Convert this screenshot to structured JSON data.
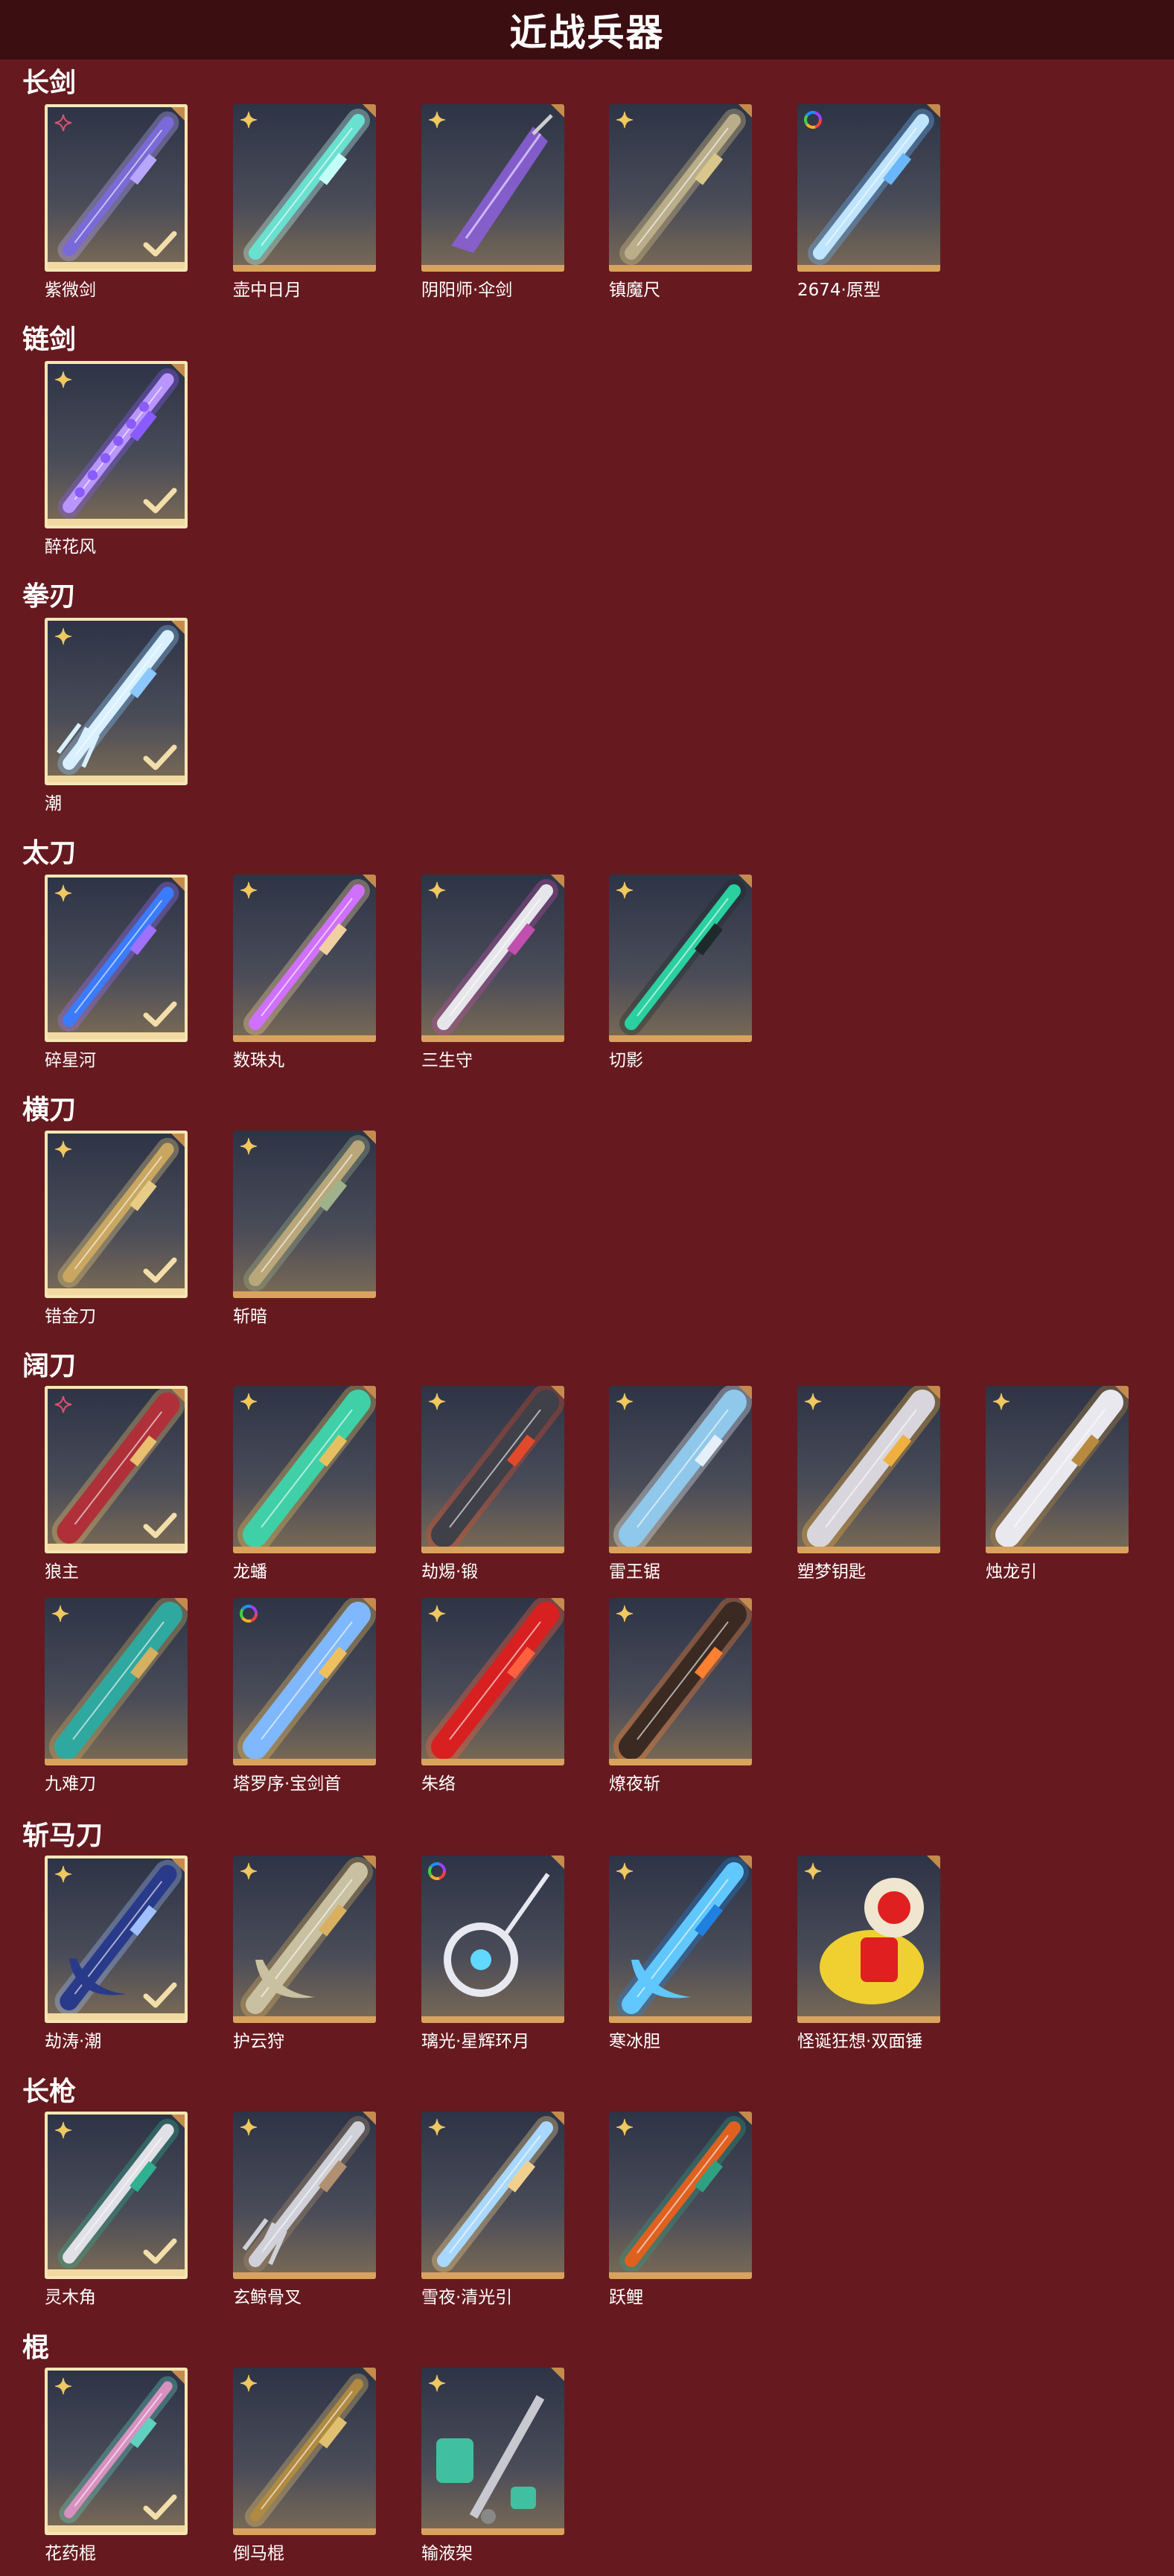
{
  "page_title": "近战兵器",
  "colors": {
    "background": "#661a1f",
    "header": "#3b0e12",
    "gold": "#d9a35e",
    "selected_border": "#f7e6b4"
  },
  "categories": [
    {
      "name": "长剑",
      "items": [
        {
          "name": "紫微剑",
          "badge": "red-star-icon",
          "selected": true,
          "art": {
            "kind": "sword",
            "blade": "#7a6ad8",
            "glow": "#b9a7ff"
          }
        },
        {
          "name": "壶中日月",
          "badge": "gold-star-icon",
          "selected": false,
          "art": {
            "kind": "sword",
            "blade": "#69e0d0",
            "glow": "#c4fff7"
          }
        },
        {
          "name": "阴阳师·伞剑",
          "badge": "gold-star-icon",
          "selected": false,
          "art": {
            "kind": "umbrella",
            "blade": "#8a5fd6",
            "glow": "#cdb6ff"
          }
        },
        {
          "name": "镇魔尺",
          "badge": "gold-star-icon",
          "selected": false,
          "art": {
            "kind": "sword",
            "blade": "#b9ad8a",
            "glow": "#d9c68b"
          }
        },
        {
          "name": "2674·原型",
          "badge": "rainbow-ring-icon",
          "selected": false,
          "art": {
            "kind": "sword",
            "blade": "#bfe4ff",
            "glow": "#6bb7ff"
          }
        }
      ]
    },
    {
      "name": "链剑",
      "items": [
        {
          "name": "醉花风",
          "badge": "gold-star-icon",
          "selected": true,
          "art": {
            "kind": "chain",
            "blade": "#b996ff",
            "glow": "#8a5cff"
          }
        }
      ]
    },
    {
      "name": "拳刃",
      "items": [
        {
          "name": "潮",
          "badge": "gold-star-icon",
          "selected": true,
          "art": {
            "kind": "claw",
            "blade": "#d8f0ff",
            "glow": "#8cc8ff"
          }
        }
      ]
    },
    {
      "name": "太刀",
      "items": [
        {
          "name": "碎星河",
          "badge": "gold-star-icon",
          "selected": true,
          "art": {
            "kind": "katana",
            "blade": "#3a7bff",
            "glow": "#a070ff"
          }
        },
        {
          "name": "数珠丸",
          "badge": "gold-star-icon",
          "selected": false,
          "art": {
            "kind": "katana",
            "blade": "#d070ff",
            "glow": "#f0d0a0"
          }
        },
        {
          "name": "三生守",
          "badge": "gold-star-icon",
          "selected": false,
          "art": {
            "kind": "katana",
            "blade": "#e6e6ea",
            "glow": "#c04fb0"
          }
        },
        {
          "name": "切影",
          "badge": "gold-star-icon",
          "selected": false,
          "art": {
            "kind": "katana",
            "blade": "#2ad0a0",
            "glow": "#1e2a2a"
          }
        }
      ]
    },
    {
      "name": "横刀",
      "items": [
        {
          "name": "错金刀",
          "badge": "gold-star-icon",
          "selected": true,
          "art": {
            "kind": "katana",
            "blade": "#c9a760",
            "glow": "#e6cc86"
          }
        },
        {
          "name": "斩暗",
          "badge": "gold-star-icon",
          "selected": false,
          "art": {
            "kind": "katana",
            "blade": "#b9a77a",
            "glow": "#9fb28c"
          }
        }
      ]
    },
    {
      "name": "阔刀",
      "items": [
        {
          "name": "狼主",
          "badge": "red-star-icon",
          "selected": true,
          "art": {
            "kind": "broad",
            "blade": "#b0303a",
            "glow": "#e8c070"
          }
        },
        {
          "name": "龙蟠",
          "badge": "gold-star-icon",
          "selected": false,
          "art": {
            "kind": "broad",
            "blade": "#3fd0a8",
            "glow": "#e6c060"
          }
        },
        {
          "name": "劫焬·锻",
          "badge": "gold-star-icon",
          "selected": false,
          "art": {
            "kind": "broad",
            "blade": "#404048",
            "glow": "#e04a2a"
          }
        },
        {
          "name": "雷王锯",
          "badge": "gold-star-icon",
          "selected": false,
          "art": {
            "kind": "broad",
            "blade": "#8fc8ea",
            "glow": "#e6eef8"
          }
        },
        {
          "name": "塑梦钥匙",
          "badge": "gold-star-icon",
          "selected": false,
          "art": {
            "kind": "broad",
            "blade": "#d8d6dc",
            "glow": "#f0b040"
          }
        },
        {
          "name": "烛龙引",
          "badge": "gold-star-icon",
          "selected": false,
          "art": {
            "kind": "broad",
            "blade": "#e8e8ee",
            "glow": "#b88a40"
          }
        },
        {
          "name": "九难刀",
          "badge": "gold-star-icon",
          "selected": false,
          "art": {
            "kind": "broad",
            "blade": "#2fa8a0",
            "glow": "#d4b060"
          }
        },
        {
          "name": "塔罗序·宝剑首",
          "badge": "rainbow-ring-icon",
          "selected": false,
          "art": {
            "kind": "broad",
            "blade": "#7fb8ff",
            "glow": "#f0c060"
          }
        },
        {
          "name": "朱络",
          "badge": "gold-star-icon",
          "selected": false,
          "art": {
            "kind": "broad",
            "blade": "#d82020",
            "glow": "#ff6040"
          }
        },
        {
          "name": "燎夜斩",
          "badge": "gold-star-icon",
          "selected": false,
          "art": {
            "kind": "broad",
            "blade": "#3a2a22",
            "glow": "#ff8030"
          }
        }
      ]
    },
    {
      "name": "斩马刀",
      "items": [
        {
          "name": "劫涛·潮",
          "badge": "gold-star-icon",
          "selected": true,
          "art": {
            "kind": "scythe",
            "blade": "#2a3a8a",
            "glow": "#a0c0ff"
          }
        },
        {
          "name": "护云狩",
          "badge": "gold-star-icon",
          "selected": false,
          "art": {
            "kind": "scythe",
            "blade": "#c8c0a0",
            "glow": "#d8b060"
          }
        },
        {
          "name": "璃光·星辉环月",
          "badge": "rainbow-ring-icon",
          "selected": false,
          "art": {
            "kind": "moon",
            "blade": "#e8e8f0",
            "glow": "#60d8ff"
          }
        },
        {
          "name": "寒冰胆",
          "badge": "gold-star-icon",
          "selected": false,
          "art": {
            "kind": "scythe",
            "blade": "#60c8ff",
            "glow": "#2080e0"
          }
        },
        {
          "name": "怪诞狂想·双面锤",
          "badge": "gold-star-icon",
          "selected": false,
          "art": {
            "kind": "hammer",
            "blade": "#e02020",
            "glow": "#f0d030"
          }
        }
      ]
    },
    {
      "name": "长枪",
      "items": [
        {
          "name": "灵木角",
          "badge": "gold-star-icon",
          "selected": true,
          "art": {
            "kind": "spear",
            "blade": "#e0e0e6",
            "glow": "#30b090"
          }
        },
        {
          "name": "玄鲸骨叉",
          "badge": "gold-star-icon",
          "selected": false,
          "art": {
            "kind": "trident",
            "blade": "#d0d0d8",
            "glow": "#b09070"
          }
        },
        {
          "name": "雪夜·清光引",
          "badge": "gold-star-icon",
          "selected": false,
          "art": {
            "kind": "spear",
            "blade": "#a8d8ff",
            "glow": "#f0d090"
          }
        },
        {
          "name": "跃鲤",
          "badge": "gold-star-icon",
          "selected": false,
          "art": {
            "kind": "spear",
            "blade": "#e06020",
            "glow": "#30a080"
          }
        }
      ]
    },
    {
      "name": "棍",
      "items": [
        {
          "name": "花药棍",
          "badge": "gold-star-icon",
          "selected": true,
          "art": {
            "kind": "staff",
            "blade": "#d890c0",
            "glow": "#60d0c0"
          }
        },
        {
          "name": "倒马棍",
          "badge": "gold-star-icon",
          "selected": false,
          "art": {
            "kind": "staff",
            "blade": "#b08a40",
            "glow": "#e0c070"
          }
        },
        {
          "name": "输液架",
          "badge": "gold-star-icon",
          "selected": false,
          "art": {
            "kind": "iv",
            "blade": "#c8c8d0",
            "glow": "#40c0a0"
          }
        }
      ]
    }
  ]
}
